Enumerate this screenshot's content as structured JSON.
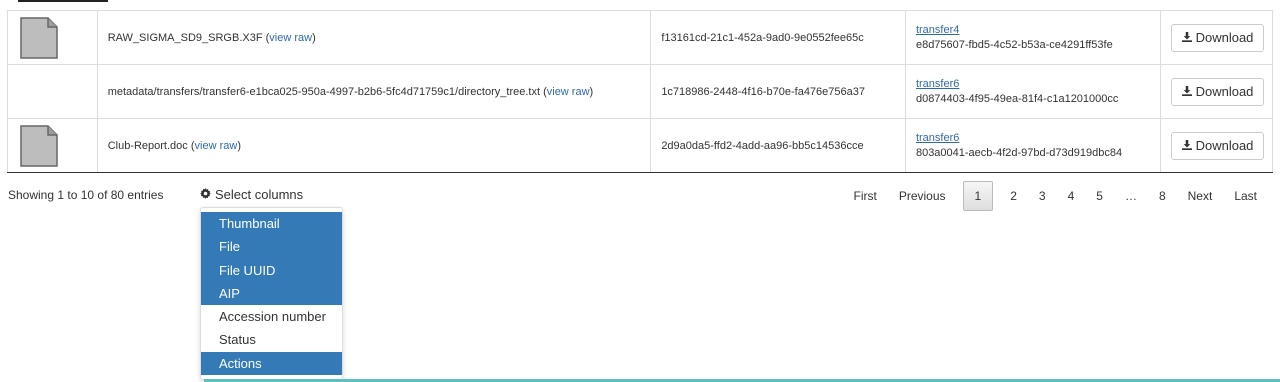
{
  "rows": [
    {
      "has_thumb": true,
      "file": "RAW_SIGMA_SD9_SRGB.X3F",
      "view_raw": "view raw",
      "uuid": "f13161cd-21c1-452a-9ad0-9e0552fee65c",
      "aip_name": "transfer4",
      "aip_uuid": "e8d75607-fbd5-4c52-b53a-ce4291ff53fe",
      "action": "Download"
    },
    {
      "has_thumb": false,
      "file": "metadata/transfers/transfer6-e1bca025-950a-4997-b2b6-5fc4d71759c1/directory_tree.txt",
      "view_raw": "view raw",
      "uuid": "1c718986-2448-4f16-b70e-fa476e756a37",
      "aip_name": "transfer6",
      "aip_uuid": "d0874403-4f95-49ea-81f4-c1a1201000cc",
      "action": "Download"
    },
    {
      "has_thumb": true,
      "file": "Club-Report.doc",
      "view_raw": "view raw",
      "uuid": "2d9a0da5-ffd2-4add-aa96-bb5c14536cce",
      "aip_name": "transfer6",
      "aip_uuid": "803a0041-aecb-4f2d-97bd-d73d919dbc84",
      "action": "Download"
    }
  ],
  "footer": {
    "info": "Showing 1 to 10 of 80 entries",
    "select_columns": "Select columns"
  },
  "columns_menu": [
    {
      "label": "Thumbnail",
      "selected": true
    },
    {
      "label": "File",
      "selected": true
    },
    {
      "label": "File UUID",
      "selected": true
    },
    {
      "label": "AIP",
      "selected": true
    },
    {
      "label": "Accession number",
      "selected": false
    },
    {
      "label": "Status",
      "selected": false
    },
    {
      "label": "Actions",
      "selected": true
    }
  ],
  "pagination": {
    "first": "First",
    "previous": "Previous",
    "pages": [
      "1",
      "2",
      "3",
      "4",
      "5",
      "…",
      "8"
    ],
    "current": "1",
    "next": "Next",
    "last": "Last"
  },
  "colors": {
    "accent": "#337ab7",
    "link": "#2f6ba8",
    "teal": "#5bc0be"
  },
  "icons": {
    "thumbnail": "generic-file-icon",
    "download": "download-icon",
    "columns": "gear-icon"
  }
}
